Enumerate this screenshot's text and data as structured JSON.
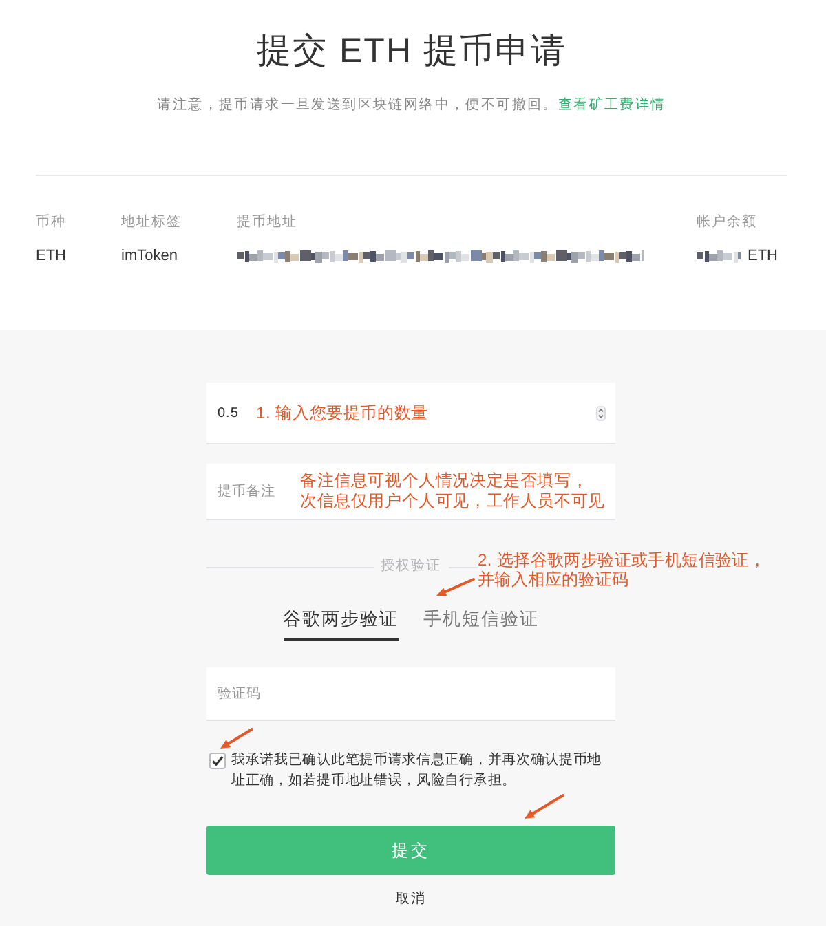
{
  "header": {
    "title": "提交 ETH 提币申请",
    "notice": "请注意，提币请求一旦发送到区块链网络中，便不可撤回。",
    "notice_link": "查看矿工费详情"
  },
  "summary": {
    "columns": [
      "币种",
      "地址标签",
      "提币地址",
      "帐户余额"
    ],
    "row": {
      "currency": "ETH",
      "address_label": "imToken",
      "balance_unit": "ETH"
    }
  },
  "amount_field": {
    "kind": "number",
    "value": "0.5",
    "annotation": "1. 输入您要提币的数量"
  },
  "memo_field": {
    "kind": "text",
    "placeholder": "提币备注",
    "annotation": "备注信息可视个人情况决定是否填写，次信息仅用户个人可见，工作人员不可见"
  },
  "auth": {
    "label": "授权验证",
    "annotation": "2. 选择谷歌两步验证或手机短信验证，并输入相应的验证码",
    "tabs": [
      {
        "label": "谷歌两步验证",
        "selected": true
      },
      {
        "label": "手机短信验证",
        "selected": false
      }
    ]
  },
  "code_field": {
    "kind": "text",
    "placeholder": "验证码"
  },
  "agreement": {
    "checked": true,
    "text": "我承诺我已确认此笔提币请求信息正确，并再次确认提币地址正确，如若提币地址错误，风险自行承担。"
  },
  "actions": {
    "submit": "提交",
    "cancel": "取消"
  }
}
